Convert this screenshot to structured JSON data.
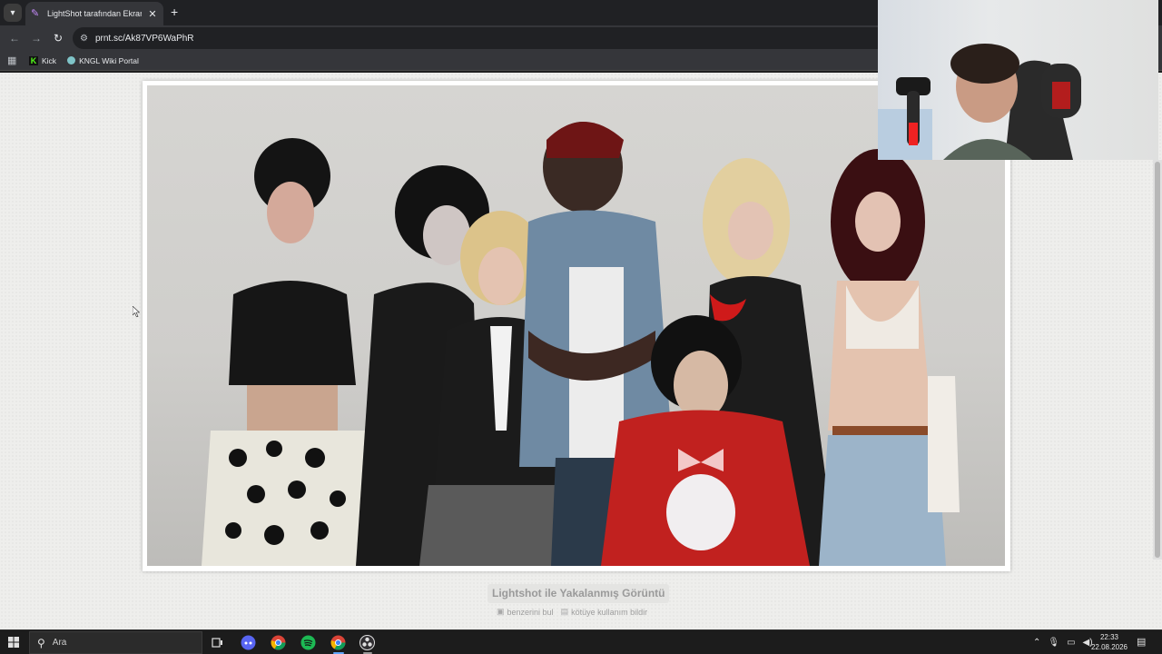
{
  "browser": {
    "tab": {
      "title": "LightShot tarafından Ekran Görüntüsü",
      "favicon": "lightshot-feather-icon"
    },
    "toolbar": {
      "url": "prnt.sc/Ak87VP6WaPhR"
    },
    "bookmarks": [
      {
        "label": "Kick",
        "icon": "kick-logo-icon"
      },
      {
        "label": "KNGL Wiki Portal",
        "icon": "globe-icon"
      }
    ]
  },
  "page": {
    "caption": "Lightshot ile Yakalanmış Görüntü",
    "actions": [
      {
        "label": "benzerini bul",
        "icon": "camera-icon"
      },
      {
        "label": "kötüye kullanım bildir",
        "icon": "report-icon"
      }
    ]
  },
  "taskbar": {
    "search_placeholder": "Ara",
    "apps": [
      "task-view-icon",
      "discord-icon",
      "chrome-icon",
      "spotify-icon",
      "chrome-icon",
      "obs-icon"
    ],
    "clock": {
      "time": "22:33",
      "date": "22.08.2026"
    }
  },
  "colors": {
    "tab_strip": "#202124",
    "toolbar": "#35363a",
    "page_background": "#eeeeec",
    "caption_text": "#9a9a9a",
    "taskbar": "#1c1c1c"
  }
}
